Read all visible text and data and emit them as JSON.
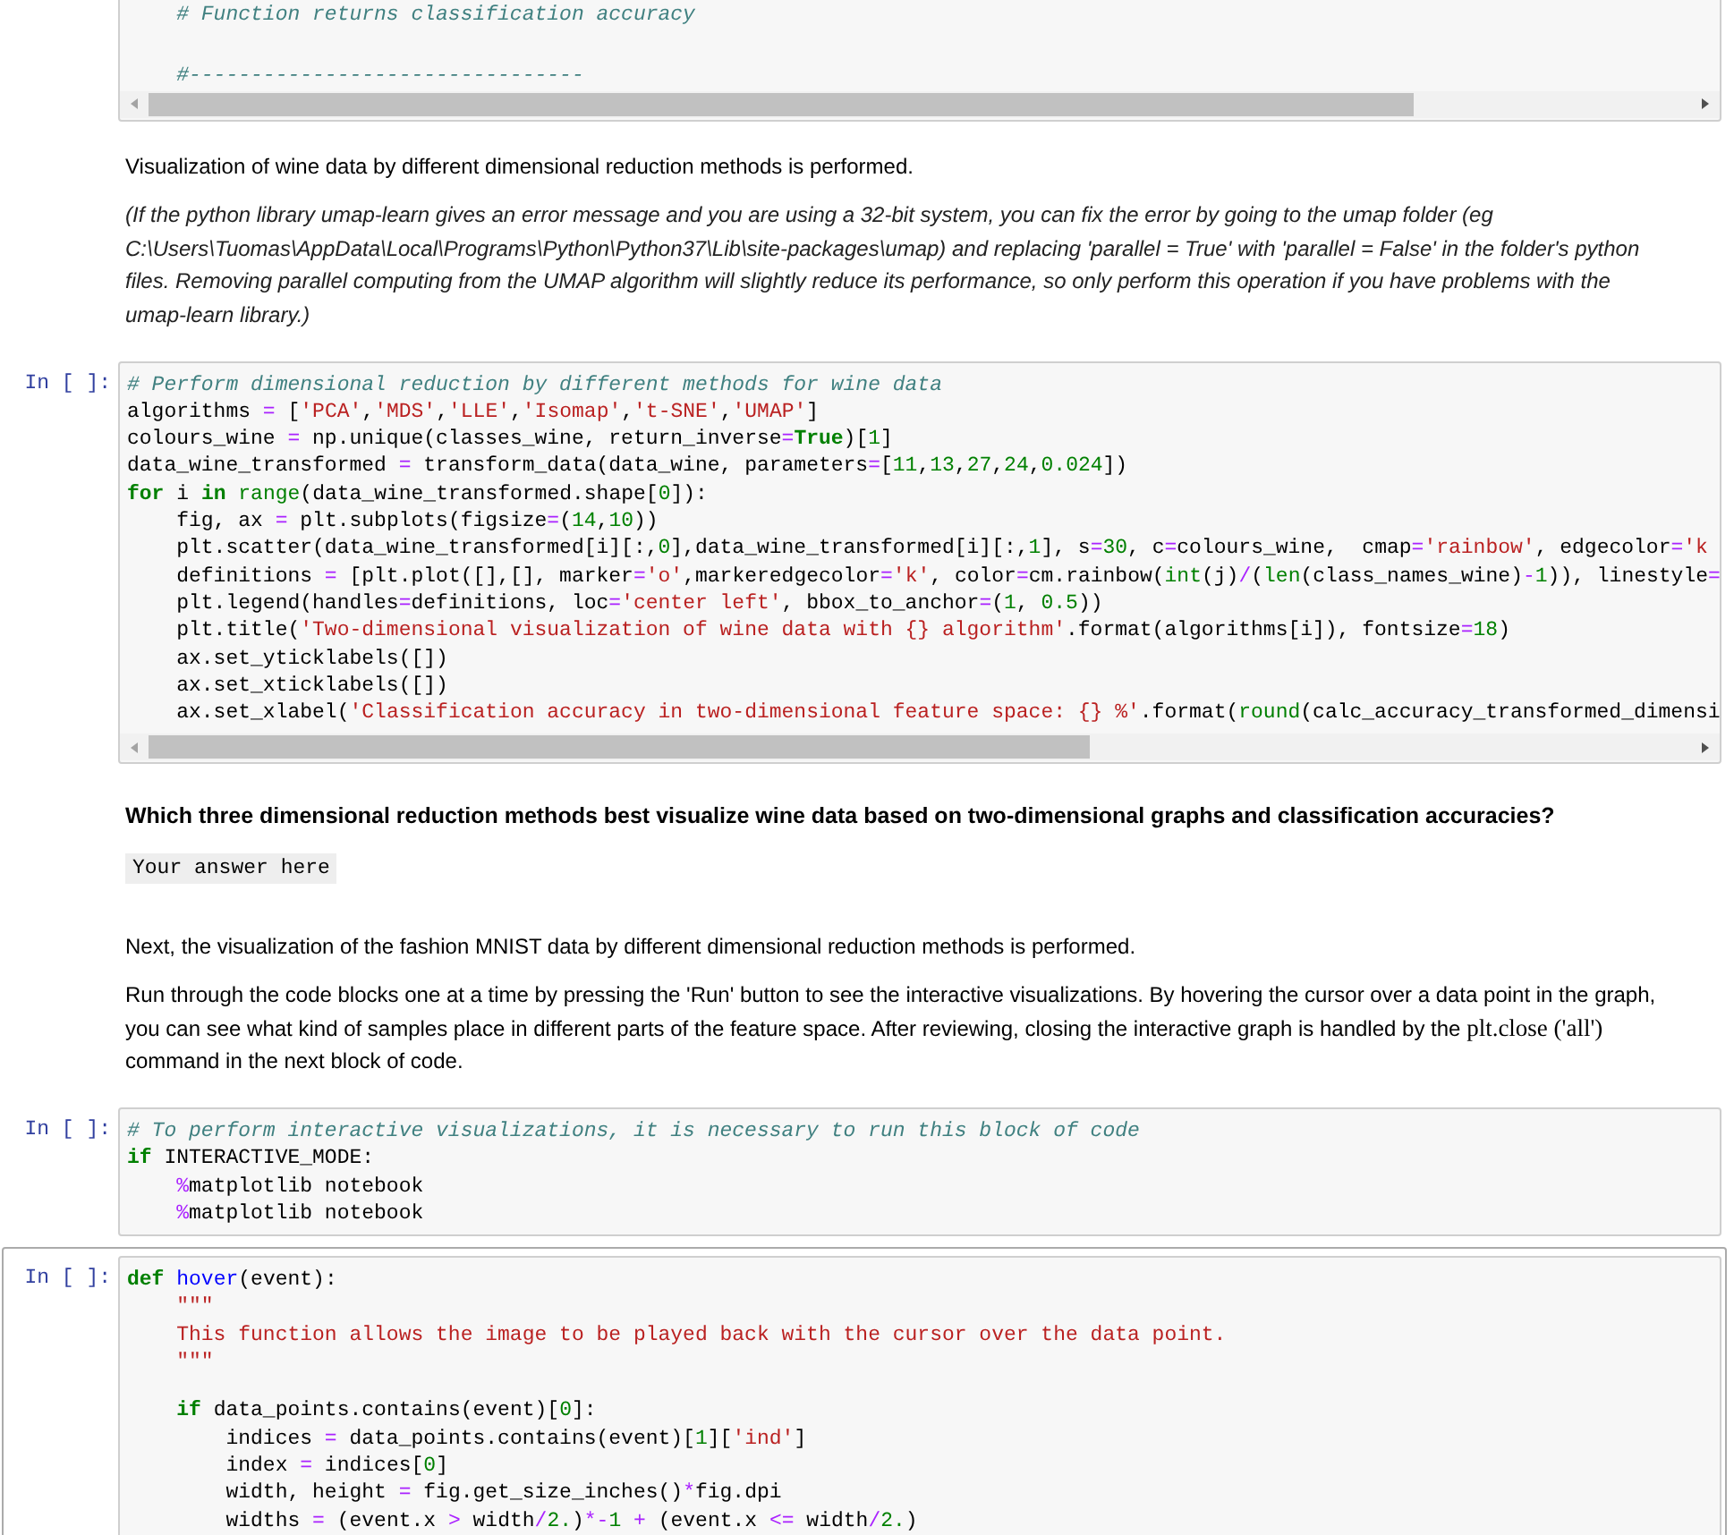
{
  "cells": [
    {
      "kind": "code",
      "selected": false,
      "scrollbar": true,
      "lines": [
        {
          "segments": [
            {
              "text": "    # Function returns classification accuracy",
              "kind": "comment"
            }
          ]
        },
        {
          "gap_before": true,
          "segments": [
            {
              "text": "    #--------------------------------",
              "kind": "comment"
            }
          ]
        }
      ]
    },
    {
      "kind": "markdown",
      "blocks": [
        {
          "kind": "p",
          "text": "Visualization of wine data by different dimensional reduction methods is performed."
        },
        {
          "kind": "note",
          "text": "(If the python library umap-learn gives an error message and you are using a 32-bit system, you can fix the error by going to the umap folder (eg C:\\Users\\Tuomas\\AppData\\Local\\Programs\\Python\\Python37\\Lib\\site-packages\\umap) and replacing 'parallel = True' with 'parallel = False' in the folder's python files. Removing parallel computing from the UMAP algorithm will slightly reduce its performance, so only perform this operation if you have problems with the umap-learn library.)"
        }
      ]
    },
    {
      "kind": "code",
      "prompt": "In [ ]:",
      "selected": false,
      "scrollbar": true,
      "lines": [
        {
          "segments": [
            {
              "text": "# Perform dimensional reduction by different methods for wine data",
              "kind": "comment"
            }
          ]
        },
        {
          "segments": [
            {
              "text": "algorithms "
            },
            {
              "text": "=",
              "kind": "operator"
            },
            {
              "text": " ["
            },
            {
              "text": "'PCA'",
              "kind": "string"
            },
            {
              "text": ","
            },
            {
              "text": "'MDS'",
              "kind": "string"
            },
            {
              "text": ","
            },
            {
              "text": "'LLE'",
              "kind": "string"
            },
            {
              "text": ","
            },
            {
              "text": "'Isomap'",
              "kind": "string"
            },
            {
              "text": ","
            },
            {
              "text": "'t-SNE'",
              "kind": "string"
            },
            {
              "text": ","
            },
            {
              "text": "'UMAP'",
              "kind": "string"
            },
            {
              "text": "]"
            }
          ]
        },
        {
          "segments": [
            {
              "text": "colours_wine "
            },
            {
              "text": "=",
              "kind": "operator"
            },
            {
              "text": " np.unique(classes_wine, return_inverse"
            },
            {
              "text": "=",
              "kind": "operator"
            },
            {
              "text": "True",
              "kind": "keyword"
            },
            {
              "text": ")["
            },
            {
              "text": "1",
              "kind": "number"
            },
            {
              "text": "]"
            }
          ]
        },
        {
          "segments": [
            {
              "text": "data_wine_transformed "
            },
            {
              "text": "=",
              "kind": "operator"
            },
            {
              "text": " transform_data(data_wine, parameters"
            },
            {
              "text": "=",
              "kind": "operator"
            },
            {
              "text": "["
            },
            {
              "text": "11",
              "kind": "number"
            },
            {
              "text": ","
            },
            {
              "text": "13",
              "kind": "number"
            },
            {
              "text": ","
            },
            {
              "text": "27",
              "kind": "number"
            },
            {
              "text": ","
            },
            {
              "text": "24",
              "kind": "number"
            },
            {
              "text": ","
            },
            {
              "text": "0.024",
              "kind": "number"
            },
            {
              "text": "])"
            }
          ]
        },
        {
          "segments": [
            {
              "text": "for",
              "kind": "keyword"
            },
            {
              "text": " i "
            },
            {
              "text": "in",
              "kind": "keyword"
            },
            {
              "text": " range",
              "kind": "builtin"
            },
            {
              "text": "(data_wine_transformed.shape["
            },
            {
              "text": "0",
              "kind": "number"
            },
            {
              "text": "]):"
            }
          ]
        },
        {
          "segments": [
            {
              "text": "    fig, ax "
            },
            {
              "text": "=",
              "kind": "operator"
            },
            {
              "text": " plt.subplots(figsize"
            },
            {
              "text": "=",
              "kind": "operator"
            },
            {
              "text": "("
            },
            {
              "text": "14",
              "kind": "number"
            },
            {
              "text": ","
            },
            {
              "text": "10",
              "kind": "number"
            },
            {
              "text": "))"
            }
          ]
        },
        {
          "segments": [
            {
              "text": "    plt.scatter(data_wine_transformed[i][:,"
            },
            {
              "text": "0",
              "kind": "number"
            },
            {
              "text": "],data_wine_transformed[i][:,"
            },
            {
              "text": "1",
              "kind": "number"
            },
            {
              "text": "], s"
            },
            {
              "text": "=",
              "kind": "operator"
            },
            {
              "text": "30",
              "kind": "number"
            },
            {
              "text": ", c"
            },
            {
              "text": "=",
              "kind": "operator"
            },
            {
              "text": "colours_wine,  cmap"
            },
            {
              "text": "=",
              "kind": "operator"
            },
            {
              "text": "'rainbow'",
              "kind": "string"
            },
            {
              "text": ", edgecolor"
            },
            {
              "text": "=",
              "kind": "operator"
            },
            {
              "text": "'k",
              "kind": "string"
            }
          ]
        },
        {
          "segments": [
            {
              "text": "    definitions "
            },
            {
              "text": "=",
              "kind": "operator"
            },
            {
              "text": " [plt.plot([],[], marker"
            },
            {
              "text": "=",
              "kind": "operator"
            },
            {
              "text": "'o'",
              "kind": "string"
            },
            {
              "text": ",markeredgecolor"
            },
            {
              "text": "=",
              "kind": "operator"
            },
            {
              "text": "'k'",
              "kind": "string"
            },
            {
              "text": ", color"
            },
            {
              "text": "=",
              "kind": "operator"
            },
            {
              "text": "cm.rainbow("
            },
            {
              "text": "int",
              "kind": "builtin"
            },
            {
              "text": "(j)"
            },
            {
              "text": "/",
              "kind": "operator"
            },
            {
              "text": "("
            },
            {
              "text": "len",
              "kind": "builtin"
            },
            {
              "text": "(class_names_wine)"
            },
            {
              "text": "-",
              "kind": "operator"
            },
            {
              "text": "1",
              "kind": "number"
            },
            {
              "text": ")), linestyle"
            },
            {
              "text": "=",
              "kind": "operator"
            }
          ]
        },
        {
          "segments": [
            {
              "text": "    plt.legend(handles"
            },
            {
              "text": "=",
              "kind": "operator"
            },
            {
              "text": "definitions, loc"
            },
            {
              "text": "=",
              "kind": "operator"
            },
            {
              "text": "'center left'",
              "kind": "string"
            },
            {
              "text": ", bbox_to_anchor"
            },
            {
              "text": "=",
              "kind": "operator"
            },
            {
              "text": "("
            },
            {
              "text": "1",
              "kind": "number"
            },
            {
              "text": ", "
            },
            {
              "text": "0.5",
              "kind": "number"
            },
            {
              "text": "))"
            }
          ]
        },
        {
          "segments": [
            {
              "text": "    plt.title("
            },
            {
              "text": "'Two-dimensional visualization of wine data with {} algorithm'",
              "kind": "string"
            },
            {
              "text": ".format(algorithms[i]), fontsize"
            },
            {
              "text": "=",
              "kind": "operator"
            },
            {
              "text": "18",
              "kind": "number"
            },
            {
              "text": ")"
            }
          ]
        },
        {
          "segments": [
            {
              "text": "    ax.set_yticklabels([])"
            }
          ]
        },
        {
          "segments": [
            {
              "text": "    ax.set_xticklabels([])"
            }
          ]
        },
        {
          "segments": [
            {
              "text": "    ax.set_xlabel("
            },
            {
              "text": "'Classification accuracy in two-dimensional feature space: {} %'",
              "kind": "string"
            },
            {
              "text": ".format("
            },
            {
              "text": "round",
              "kind": "builtin"
            },
            {
              "text": "(calc_accuracy_transformed_dimensi"
            }
          ]
        }
      ]
    },
    {
      "kind": "markdown",
      "blocks": [
        {
          "kind": "question",
          "text": "Which three dimensional reduction methods best visualize wine data based on two-dimensional graphs and classification accuracies?"
        },
        {
          "kind": "answer",
          "text": "Your answer here"
        }
      ]
    },
    {
      "kind": "markdown",
      "blocks": [
        {
          "kind": "p",
          "text": "Next, the visualization of the fashion MNIST data by different dimensional reduction methods is performed."
        },
        {
          "kind": "mixed",
          "before": "Run through the code blocks one at a time by pressing the 'Run' button to see the interactive visualizations. By hovering the cursor over a data point in the graph, you can see what kind of samples place in different parts of the feature space. After reviewing, closing the interactive graph is handled by the ",
          "code": "plt.close ('all')",
          "after": " command in the next block of code."
        }
      ]
    },
    {
      "kind": "code",
      "prompt": "In [ ]:",
      "selected": false,
      "scrollbar": false,
      "lines": [
        {
          "segments": [
            {
              "text": "# To perform interactive visualizations, it is necessary to run this block of code",
              "kind": "comment"
            }
          ]
        },
        {
          "segments": [
            {
              "text": "if",
              "kind": "keyword"
            },
            {
              "text": " INTERACTIVE_MODE:"
            }
          ]
        },
        {
          "segments": [
            {
              "text": "    %",
              "kind": "operator"
            },
            {
              "text": "matplotlib notebook"
            }
          ]
        },
        {
          "segments": [
            {
              "text": "    %",
              "kind": "operator"
            },
            {
              "text": "matplotlib notebook"
            }
          ]
        }
      ]
    },
    {
      "kind": "code",
      "prompt": "In [ ]:",
      "selected": true,
      "scrollbar": false,
      "lines": [
        {
          "segments": [
            {
              "text": "def",
              "kind": "keyword"
            },
            {
              "text": " hover",
              "kind": "function"
            },
            {
              "text": "(event):"
            }
          ]
        },
        {
          "segments": [
            {
              "text": "    \"\"\"",
              "kind": "string"
            }
          ]
        },
        {
          "segments": [
            {
              "text": "    This function allows the image to be played back with the cursor over the data point.",
              "kind": "string"
            }
          ]
        },
        {
          "segments": [
            {
              "text": "    \"\"\"",
              "kind": "string"
            }
          ]
        },
        {
          "gap_before": true,
          "segments": [
            {
              "text": "    if",
              "kind": "keyword"
            },
            {
              "text": " data_points.contains(event)["
            },
            {
              "text": "0",
              "kind": "number"
            },
            {
              "text": "]:"
            }
          ]
        },
        {
          "segments": [
            {
              "text": "        indices "
            },
            {
              "text": "=",
              "kind": "operator"
            },
            {
              "text": " data_points.contains(event)["
            },
            {
              "text": "1",
              "kind": "number"
            },
            {
              "text": "]["
            },
            {
              "text": "'ind'",
              "kind": "string"
            },
            {
              "text": "]"
            }
          ]
        },
        {
          "segments": [
            {
              "text": "        index "
            },
            {
              "text": "=",
              "kind": "operator"
            },
            {
              "text": " indices["
            },
            {
              "text": "0",
              "kind": "number"
            },
            {
              "text": "]"
            }
          ]
        },
        {
          "segments": [
            {
              "text": "        width, height "
            },
            {
              "text": "=",
              "kind": "operator"
            },
            {
              "text": " fig.get_size_inches()"
            },
            {
              "text": "*",
              "kind": "operator"
            },
            {
              "text": "fig.dpi"
            }
          ]
        },
        {
          "segments": [
            {
              "text": "        widths "
            },
            {
              "text": "=",
              "kind": "operator"
            },
            {
              "text": " (event.x "
            },
            {
              "text": ">",
              "kind": "operator"
            },
            {
              "text": " width"
            },
            {
              "text": "/",
              "kind": "operator"
            },
            {
              "text": "2.",
              "kind": "number"
            },
            {
              "text": ")"
            },
            {
              "text": "*-",
              "kind": "operator"
            },
            {
              "text": "1",
              "kind": "number"
            },
            {
              "text": " +",
              "kind": "operator"
            },
            {
              "text": " (event.x "
            },
            {
              "text": "<=",
              "kind": "operator"
            },
            {
              "text": " width"
            },
            {
              "text": "/",
              "kind": "operator"
            },
            {
              "text": "2.",
              "kind": "number"
            },
            {
              "text": ")"
            }
          ]
        }
      ]
    }
  ]
}
